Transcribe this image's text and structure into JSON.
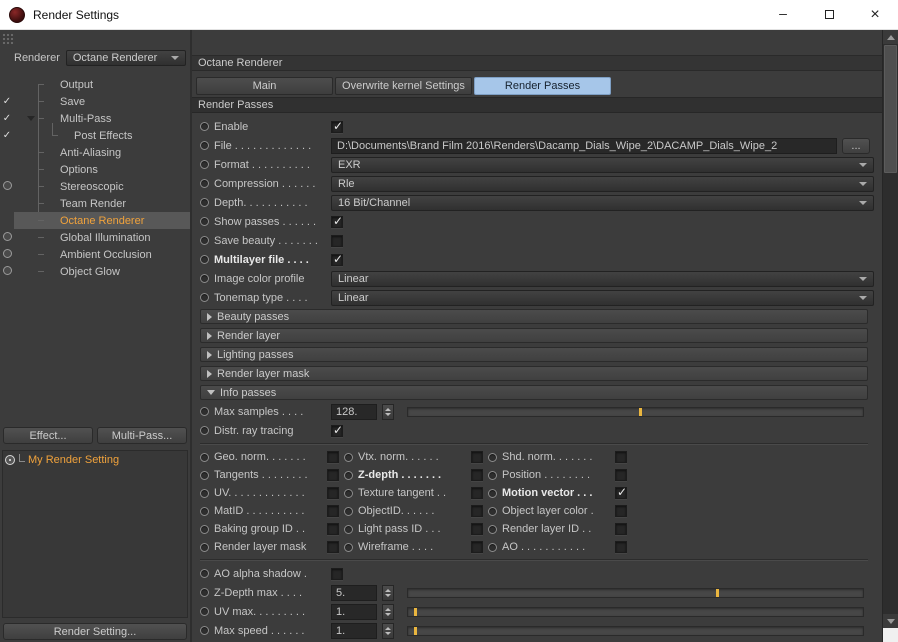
{
  "titlebar": {
    "title": "Render Settings",
    "minimize": "–",
    "close": "×"
  },
  "sidebar": {
    "renderer_label": "Renderer",
    "renderer_value": "Octane Renderer",
    "tree": [
      {
        "label": "Output",
        "state": "none"
      },
      {
        "label": "Save",
        "state": "check"
      },
      {
        "label": "Multi-Pass",
        "state": "check",
        "expanded": true
      },
      {
        "label": "Post Effects",
        "state": "check",
        "child": true
      },
      {
        "label": "Anti-Aliasing",
        "state": "none"
      },
      {
        "label": "Options",
        "state": "none"
      },
      {
        "label": "Stereoscopic",
        "state": "led"
      },
      {
        "label": "Team Render",
        "state": "none"
      },
      {
        "label": "Octane Renderer",
        "state": "none",
        "selected": true
      },
      {
        "label": "Global Illumination",
        "state": "led"
      },
      {
        "label": "Ambient Occlusion",
        "state": "led"
      },
      {
        "label": "Object Glow",
        "state": "led"
      }
    ],
    "effect_button": "Effect...",
    "multipass_button": "Multi-Pass...",
    "my_render_setting": "My Render Setting",
    "render_setting_button": "Render Setting..."
  },
  "main": {
    "header": "Octane Renderer",
    "tabs": [
      {
        "label": "Main",
        "active": false
      },
      {
        "label": "Overwrite kernel Settings",
        "active": false
      },
      {
        "label": "Render Passes",
        "active": true
      }
    ],
    "section": "Render Passes",
    "enable": {
      "label": "Enable",
      "checked": true
    },
    "file": {
      "label": "File . . . . . . . . . . . . .",
      "value": "D:\\Documents\\Brand Film 2016\\Renders\\Dacamp_Dials_Wipe_2\\DACAMP_Dials_Wipe_2",
      "browse": "..."
    },
    "format": {
      "label": "Format . . . . . . . . . .",
      "value": "EXR"
    },
    "compression": {
      "label": "Compression . . . . . .",
      "value": "Rle"
    },
    "depth": {
      "label": "Depth. . . . . . . . . . .",
      "value": "16 Bit/Channel"
    },
    "show_passes": {
      "label": "Show passes . . . . . .",
      "checked": true
    },
    "save_beauty": {
      "label": "Save beauty . . . . . . .",
      "checked": false
    },
    "multilayer_file": {
      "label": "Multilayer file . . . .",
      "checked": true,
      "bold": true
    },
    "image_color_profile": {
      "label": "Image color profile",
      "value": "Linear"
    },
    "tonemap_type": {
      "label": "Tonemap type . . . .",
      "value": "Linear"
    },
    "groups": [
      {
        "label": "Beauty passes",
        "expanded": false
      },
      {
        "label": "Render layer",
        "expanded": false
      },
      {
        "label": "Lighting passes",
        "expanded": false
      },
      {
        "label": "Render layer mask",
        "expanded": false
      },
      {
        "label": "Info passes",
        "expanded": true
      }
    ],
    "max_samples": {
      "label": "Max samples . . . .",
      "value": "128.",
      "slider_pct": 51
    },
    "distr_ray_tracing": {
      "label": "Distr. ray tracing",
      "checked": true
    },
    "passes_grid": [
      {
        "label": "Geo. norm. . . . . . .",
        "checked": false
      },
      {
        "label": "Vtx. norm. . . . . .",
        "checked": false
      },
      {
        "label": "Shd. norm. . . . . . .",
        "checked": false
      },
      {
        "label": "Tangents . . . . . . . .",
        "checked": false
      },
      {
        "label": "Z-depth . . . . . . .",
        "checked": false,
        "bold": true
      },
      {
        "label": "Position . . . . . . . .",
        "checked": false
      },
      {
        "label": "UV. . . . . . . . . . . . .",
        "checked": false
      },
      {
        "label": "Texture tangent . .",
        "checked": false
      },
      {
        "label": "Motion vector . . .",
        "checked": true,
        "bold": true
      },
      {
        "label": "MatID . . . . . . . . . .",
        "checked": false
      },
      {
        "label": "ObjectID. . . . . .",
        "checked": false
      },
      {
        "label": "Object layer color .",
        "checked": false
      },
      {
        "label": "Baking group ID . .",
        "checked": false
      },
      {
        "label": "Light pass ID . . .",
        "checked": false
      },
      {
        "label": "Render layer ID . .",
        "checked": false
      },
      {
        "label": "Render layer mask",
        "checked": false
      },
      {
        "label": "Wireframe . . . .",
        "checked": false
      },
      {
        "label": "AO . . . . . . . . . . .",
        "checked": false
      }
    ],
    "ao_alpha_shadow": {
      "label": "AO alpha shadow .",
      "checked": false
    },
    "zdepth_max": {
      "label": "Z-Depth max . . . .",
      "value": "5.",
      "slider_pct": 68
    },
    "uv_max": {
      "label": "UV max. . . . . . . . .",
      "value": "1.",
      "slider_pct": 1.5
    },
    "max_speed": {
      "label": "Max speed . . . . . .",
      "value": "1.",
      "slider_pct": 1.5
    }
  }
}
